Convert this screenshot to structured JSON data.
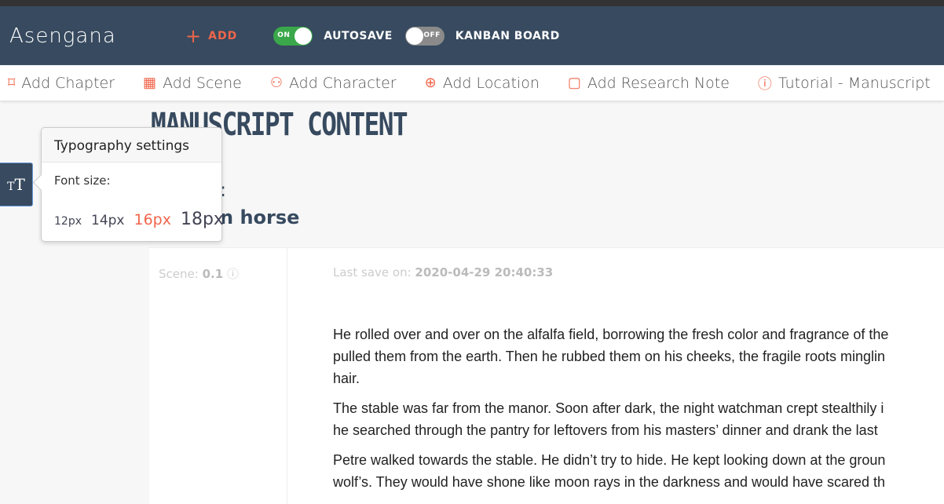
{
  "nav": {
    "logo": "Asengana",
    "add": "ADD",
    "autosave": {
      "label": "AUTOSAVE",
      "state": "ON"
    },
    "kanban": {
      "label": "KANBAN BOARD",
      "state": "OFF"
    }
  },
  "toolbar": [
    {
      "label": "Add Chapter",
      "icon": "bookmark-icon",
      "glyph": "⌑"
    },
    {
      "label": "Add Scene",
      "icon": "film-icon",
      "glyph": "▦"
    },
    {
      "label": "Add Character",
      "icon": "user-plus-icon",
      "glyph": "⚇"
    },
    {
      "label": "Add Location",
      "icon": "map-pin-icon",
      "glyph": "⊕"
    },
    {
      "label": "Add Research Note",
      "icon": "note-icon",
      "glyph": "▢"
    },
    {
      "label": "Tutorial - Manuscript",
      "icon": "info-icon",
      "glyph": "ⓘ"
    }
  ],
  "main": {
    "title": "MANUSCRIPT CONTENT",
    "fragment1": ":",
    "fragment2": "n horse",
    "scene_label": "Scene:",
    "scene_value": "0.1",
    "last_save_label": "Last save on:",
    "last_save_value": "2020-04-29 20:40:33",
    "paragraphs": [
      "He rolled over and over on the alfalfa field, borrowing the fresh color and fragrance of the|pulled them from the earth. Then he rubbed them on his cheeks, the fragile roots minglin|hair.",
      "The stable was far from the manor. Soon after dark, the night watchman crept stealthily i|he searched through the pantry for leftovers from his masters’ dinner and drank the last",
      "Petre walked towards the stable. He didn’t try to hide. He kept looking down at the groun|wolf’s. They would have shone like moon rays in the darkness and would have scared th"
    ]
  },
  "typography": {
    "title": "Typography settings",
    "font_size_label": "Font size:",
    "sizes": [
      "12px",
      "14px",
      "16px",
      "18px"
    ],
    "selected": "16px"
  },
  "colors": {
    "nav": "#374a5f",
    "accent": "#f0654a",
    "on": "#3aa84a"
  }
}
